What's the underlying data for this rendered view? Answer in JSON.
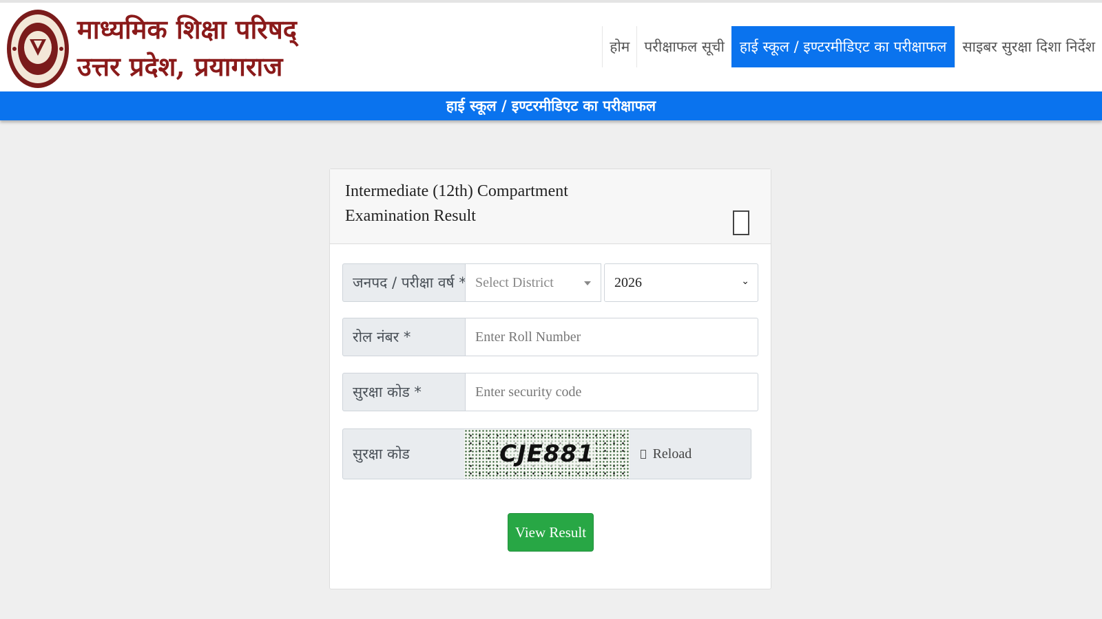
{
  "header": {
    "org_line1": "माध्यमिक शिक्षा परिषद्",
    "org_line2": "उत्तर प्रदेश, प्रयागराज",
    "logo_icon": "up-board-emblem-logo"
  },
  "nav": {
    "items": [
      {
        "label": "होम",
        "active": false
      },
      {
        "label": "परीक्षाफल सूची",
        "active": false
      },
      {
        "label": "हाई स्कूल / इण्टरमीडिएट का परीक्षाफल",
        "active": true
      },
      {
        "label": "साइबर सुरक्षा दिशा निर्देश",
        "active": false
      }
    ]
  },
  "banner": {
    "title": "हाई स्कूल / इण्टरमीडिएट का परीक्षाफल"
  },
  "form": {
    "title_line1": "Intermediate (12th) Compartment",
    "title_line2": "Examination Result",
    "district_year_label": "जनपद / परीक्षा वर्ष *",
    "district_placeholder": "Select District",
    "year_value": "2026",
    "roll_label": "रोल नंबर *",
    "roll_placeholder": "Enter Roll Number",
    "security_label": "सुरक्षा कोड *",
    "security_placeholder": "Enter security code",
    "captcha_label": "सुरक्षा कोड",
    "captcha_text": "CJE881",
    "reload_label": "Reload",
    "submit_label": "View Result"
  },
  "colors": {
    "primary_blue": "#0a73ee",
    "brand_maroon": "#8a1a1a",
    "submit_green": "#28a745"
  }
}
